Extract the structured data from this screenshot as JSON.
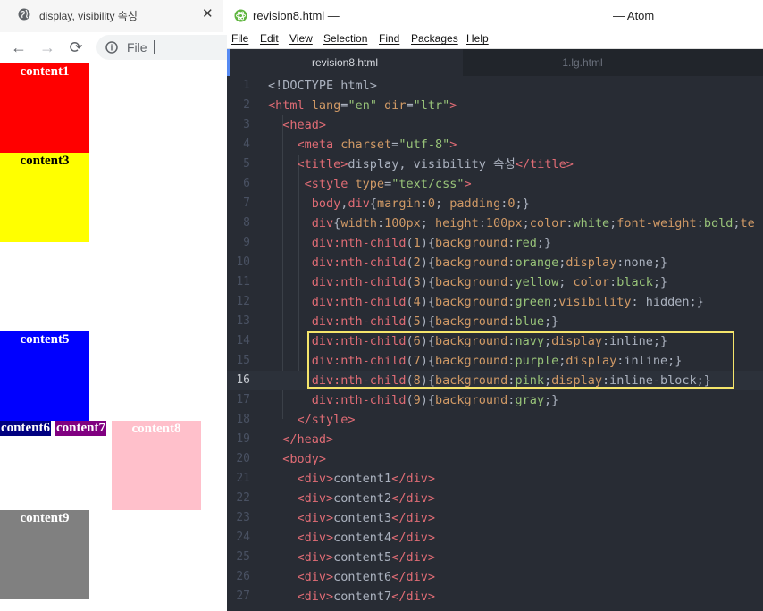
{
  "browser": {
    "tab_title": "display, visibility 속성",
    "tab_close": "✕",
    "url_scheme": "File",
    "nav": {
      "back": "←",
      "forward": "→",
      "reload": "⟳"
    },
    "boxes": [
      {
        "label": "content1",
        "color": "#ff0000",
        "text_color": "#ffffff"
      },
      {
        "label": "content3",
        "color": "#ffff00",
        "text_color": "#000000"
      },
      {
        "label": "content5",
        "color": "#0000ff",
        "text_color": "#ffffff"
      },
      {
        "label": "content6",
        "color": "#000080",
        "text_color": "#ffffff"
      },
      {
        "label": "content7",
        "color": "#800080",
        "text_color": "#ffffff"
      },
      {
        "label": "content8",
        "color": "#ffc0cb",
        "text_color": "#ffffff"
      },
      {
        "label": "content9",
        "color": "#808080",
        "text_color": "#ffffff"
      }
    ]
  },
  "atom": {
    "file_title": "revision8.html —",
    "app_name": "— Atom",
    "menu": [
      "File",
      "Edit",
      "View",
      "Selection",
      "Find",
      "Packages",
      "Help"
    ],
    "tabs": [
      {
        "label": "revision8.html",
        "active": true
      },
      {
        "label": "1.lg.html",
        "active": false
      }
    ],
    "cursor_line": 16,
    "highlight_color": "#f5e56b",
    "lines": [
      [
        [
          "t",
          "<!DOCTYPE html>"
        ]
      ],
      [
        [
          "g",
          "<html "
        ],
        [
          "a",
          "lang"
        ],
        [
          "t",
          "="
        ],
        [
          "s",
          "\"en\""
        ],
        [
          "t",
          " "
        ],
        [
          "a",
          "dir"
        ],
        [
          "t",
          "="
        ],
        [
          "s",
          "\"ltr\""
        ],
        [
          "g",
          ">"
        ]
      ],
      [
        [
          "t",
          "  "
        ],
        [
          "g",
          "<head>"
        ]
      ],
      [
        [
          "t",
          "    "
        ],
        [
          "g",
          "<meta "
        ],
        [
          "a",
          "charset"
        ],
        [
          "t",
          "="
        ],
        [
          "s",
          "\"utf-8\""
        ],
        [
          "g",
          ">"
        ]
      ],
      [
        [
          "t",
          "    "
        ],
        [
          "g",
          "<title>"
        ],
        [
          "t",
          "display, visibility 속성"
        ],
        [
          "g",
          "</title>"
        ]
      ],
      [
        [
          "t",
          "     "
        ],
        [
          "g",
          "<style "
        ],
        [
          "a",
          "type"
        ],
        [
          "t",
          "="
        ],
        [
          "s",
          "\"text/css\""
        ],
        [
          "g",
          ">"
        ]
      ],
      [
        [
          "t",
          "      "
        ],
        [
          "g",
          "body"
        ],
        [
          "t",
          ","
        ],
        [
          "g",
          "div"
        ],
        [
          "t",
          "{"
        ],
        [
          "a",
          "margin"
        ],
        [
          "t",
          ":"
        ],
        [
          "n",
          "0"
        ],
        [
          "t",
          "; "
        ],
        [
          "a",
          "padding"
        ],
        [
          "t",
          ":"
        ],
        [
          "n",
          "0"
        ],
        [
          "t",
          ";}"
        ]
      ],
      [
        [
          "t",
          "      "
        ],
        [
          "g",
          "div"
        ],
        [
          "t",
          "{"
        ],
        [
          "a",
          "width"
        ],
        [
          "t",
          ":"
        ],
        [
          "n",
          "100px"
        ],
        [
          "t",
          "; "
        ],
        [
          "a",
          "height"
        ],
        [
          "t",
          ":"
        ],
        [
          "n",
          "100px"
        ],
        [
          "t",
          ";"
        ],
        [
          "a",
          "color"
        ],
        [
          "t",
          ":"
        ],
        [
          "s",
          "white"
        ],
        [
          "t",
          ";"
        ],
        [
          "a",
          "font-weight"
        ],
        [
          "t",
          ":"
        ],
        [
          "s",
          "bold"
        ],
        [
          "t",
          ";"
        ],
        [
          "a",
          "te"
        ]
      ],
      [
        [
          "t",
          "      "
        ],
        [
          "g",
          "div:nth-child"
        ],
        [
          "t",
          "("
        ],
        [
          "n",
          "1"
        ],
        [
          "t",
          ")"
        ],
        [
          "t",
          "{"
        ],
        [
          "a",
          "background"
        ],
        [
          "t",
          ":"
        ],
        [
          "s",
          "red"
        ],
        [
          "t",
          ";}"
        ]
      ],
      [
        [
          "t",
          "      "
        ],
        [
          "g",
          "div:nth-child"
        ],
        [
          "t",
          "("
        ],
        [
          "n",
          "2"
        ],
        [
          "t",
          ")"
        ],
        [
          "t",
          "{"
        ],
        [
          "a",
          "background"
        ],
        [
          "t",
          ":"
        ],
        [
          "s",
          "orange"
        ],
        [
          "t",
          ";"
        ],
        [
          "a",
          "display"
        ],
        [
          "t",
          ":none;}"
        ]
      ],
      [
        [
          "t",
          "      "
        ],
        [
          "g",
          "div:nth-child"
        ],
        [
          "t",
          "("
        ],
        [
          "n",
          "3"
        ],
        [
          "t",
          ")"
        ],
        [
          "t",
          "{"
        ],
        [
          "a",
          "background"
        ],
        [
          "t",
          ":"
        ],
        [
          "s",
          "yellow"
        ],
        [
          "t",
          "; "
        ],
        [
          "a",
          "color"
        ],
        [
          "t",
          ":"
        ],
        [
          "s",
          "black"
        ],
        [
          "t",
          ";}"
        ]
      ],
      [
        [
          "t",
          "      "
        ],
        [
          "g",
          "div:nth-child"
        ],
        [
          "t",
          "("
        ],
        [
          "n",
          "4"
        ],
        [
          "t",
          ")"
        ],
        [
          "t",
          "{"
        ],
        [
          "a",
          "background"
        ],
        [
          "t",
          ":"
        ],
        [
          "s",
          "green"
        ],
        [
          "t",
          ";"
        ],
        [
          "a",
          "visibility"
        ],
        [
          "t",
          ": hidden;}"
        ]
      ],
      [
        [
          "t",
          "      "
        ],
        [
          "g",
          "div:nth-child"
        ],
        [
          "t",
          "("
        ],
        [
          "n",
          "5"
        ],
        [
          "t",
          ")"
        ],
        [
          "t",
          "{"
        ],
        [
          "a",
          "background"
        ],
        [
          "t",
          ":"
        ],
        [
          "s",
          "blue"
        ],
        [
          "t",
          ";}"
        ]
      ],
      [
        [
          "t",
          "      "
        ],
        [
          "g",
          "div:nth-child"
        ],
        [
          "t",
          "("
        ],
        [
          "n",
          "6"
        ],
        [
          "t",
          ")"
        ],
        [
          "t",
          "{"
        ],
        [
          "a",
          "background"
        ],
        [
          "t",
          ":"
        ],
        [
          "s",
          "navy"
        ],
        [
          "t",
          ";"
        ],
        [
          "a",
          "display"
        ],
        [
          "t",
          ":inline;}"
        ]
      ],
      [
        [
          "t",
          "      "
        ],
        [
          "g",
          "div:nth-child"
        ],
        [
          "t",
          "("
        ],
        [
          "n",
          "7"
        ],
        [
          "t",
          ")"
        ],
        [
          "t",
          "{"
        ],
        [
          "a",
          "background"
        ],
        [
          "t",
          ":"
        ],
        [
          "s",
          "purple"
        ],
        [
          "t",
          ";"
        ],
        [
          "a",
          "display"
        ],
        [
          "t",
          ":inline;}"
        ]
      ],
      [
        [
          "t",
          "      "
        ],
        [
          "g",
          "div:nth-child"
        ],
        [
          "t",
          "("
        ],
        [
          "n",
          "8"
        ],
        [
          "t",
          ")"
        ],
        [
          "t",
          "{"
        ],
        [
          "a",
          "background"
        ],
        [
          "t",
          ":"
        ],
        [
          "s",
          "pink"
        ],
        [
          "t",
          ";"
        ],
        [
          "a",
          "display"
        ],
        [
          "t",
          ":inline-block;}"
        ]
      ],
      [
        [
          "t",
          "      "
        ],
        [
          "g",
          "div:nth-child"
        ],
        [
          "t",
          "("
        ],
        [
          "n",
          "9"
        ],
        [
          "t",
          ")"
        ],
        [
          "t",
          "{"
        ],
        [
          "a",
          "background"
        ],
        [
          "t",
          ":"
        ],
        [
          "s",
          "gray"
        ],
        [
          "t",
          ";}"
        ]
      ],
      [
        [
          "t",
          "    "
        ],
        [
          "g",
          "</style>"
        ]
      ],
      [
        [
          "t",
          "  "
        ],
        [
          "g",
          "</head>"
        ]
      ],
      [
        [
          "t",
          "  "
        ],
        [
          "g",
          "<body>"
        ]
      ],
      [
        [
          "t",
          "    "
        ],
        [
          "g",
          "<div>"
        ],
        [
          "t",
          "content1"
        ],
        [
          "g",
          "</div>"
        ]
      ],
      [
        [
          "t",
          "    "
        ],
        [
          "g",
          "<div>"
        ],
        [
          "t",
          "content2"
        ],
        [
          "g",
          "</div>"
        ]
      ],
      [
        [
          "t",
          "    "
        ],
        [
          "g",
          "<div>"
        ],
        [
          "t",
          "content3"
        ],
        [
          "g",
          "</div>"
        ]
      ],
      [
        [
          "t",
          "    "
        ],
        [
          "g",
          "<div>"
        ],
        [
          "t",
          "content4"
        ],
        [
          "g",
          "</div>"
        ]
      ],
      [
        [
          "t",
          "    "
        ],
        [
          "g",
          "<div>"
        ],
        [
          "t",
          "content5"
        ],
        [
          "g",
          "</div>"
        ]
      ],
      [
        [
          "t",
          "    "
        ],
        [
          "g",
          "<div>"
        ],
        [
          "t",
          "content6"
        ],
        [
          "g",
          "</div>"
        ]
      ],
      [
        [
          "t",
          "    "
        ],
        [
          "g",
          "<div>"
        ],
        [
          "t",
          "content7"
        ],
        [
          "g",
          "</div>"
        ]
      ]
    ]
  }
}
